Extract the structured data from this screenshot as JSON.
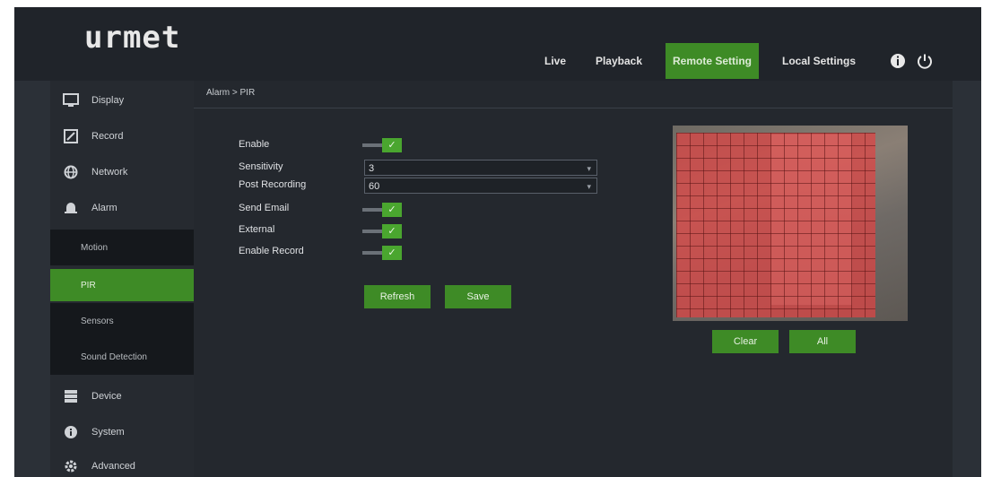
{
  "app": {
    "logo": "urmet"
  },
  "header": {
    "nav": [
      {
        "label": "Live"
      },
      {
        "label": "Playback"
      },
      {
        "label": "Remote Setting",
        "active": true
      },
      {
        "label": "Local Settings"
      }
    ],
    "icons": [
      "info-icon",
      "power-icon"
    ]
  },
  "sidebar": {
    "items": [
      {
        "label": "Display",
        "icon": "display-icon"
      },
      {
        "label": "Record",
        "icon": "record-icon"
      },
      {
        "label": "Network",
        "icon": "network-icon"
      },
      {
        "label": "Alarm",
        "icon": "alarm-icon"
      },
      {
        "label": "Device",
        "icon": "device-icon"
      },
      {
        "label": "System",
        "icon": "system-icon"
      },
      {
        "label": "Advanced",
        "icon": "advanced-icon"
      }
    ],
    "alarm_sub": [
      {
        "label": "Motion"
      },
      {
        "label": "PIR",
        "active": true
      },
      {
        "label": "Sensors"
      },
      {
        "label": "Sound Detection"
      }
    ]
  },
  "main": {
    "breadcrumb": "Alarm > PIR",
    "form": {
      "enable": {
        "label": "Enable",
        "checked": true
      },
      "sensitivity": {
        "label": "Sensitivity",
        "value": "3"
      },
      "post_recording": {
        "label": "Post Recording",
        "value": "60"
      },
      "send_email": {
        "label": "Send Email",
        "checked": true
      },
      "external": {
        "label": "External",
        "checked": true
      },
      "enable_record": {
        "label": "Enable Record",
        "checked": true
      }
    },
    "buttons": {
      "refresh": "Refresh",
      "save": "Save",
      "clear": "Clear",
      "all": "All"
    },
    "check_glyph": "✓",
    "colors": {
      "accent": "#3e8b26",
      "toggle_on": "#4aa62f",
      "detection_area": "#e04444"
    }
  }
}
